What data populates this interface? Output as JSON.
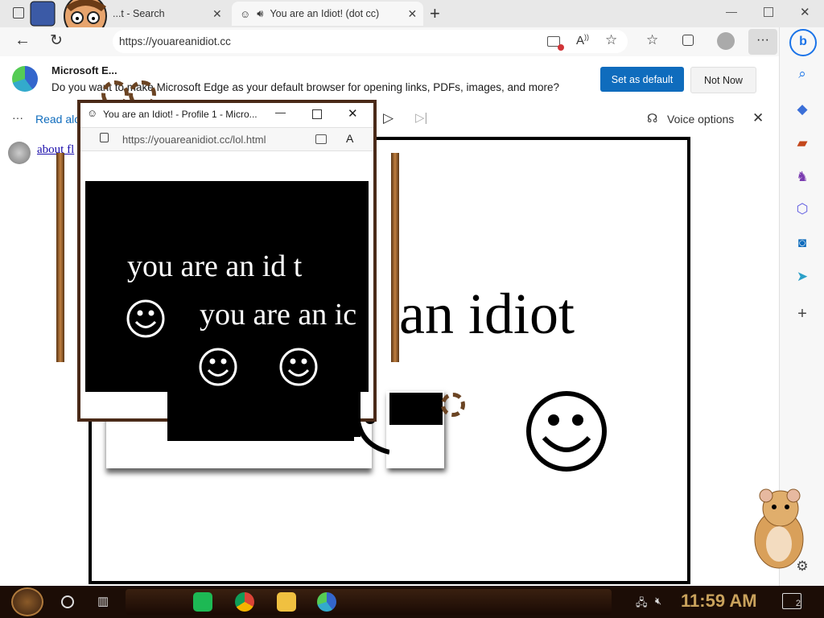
{
  "tabs": [
    {
      "title": "...t - Search"
    },
    {
      "title": "You are an Idiot! (dot cc)"
    }
  ],
  "toolbar": {
    "url": "https://youareanidiot.cc"
  },
  "infobar": {
    "title": "Microsoft E...",
    "message": "Do you want to make Microsoft Edge as your default browser for opening links, PDFs, images, and more?",
    "set_default": "Set as default",
    "not_now": "Not Now"
  },
  "readbar": {
    "label": "Read alo",
    "voice_options": "Voice options"
  },
  "page": {
    "link_text": "about fl",
    "main_text": "an idiot",
    "popup_text_a": "you are an id  t",
    "popup_text_b": "you are an ic"
  },
  "popup": {
    "title": "You are an Idiot! - Profile 1 - Micro...",
    "url": "https://youareanidiot.cc/lol.html"
  },
  "taskbar": {
    "time": "11:59 AM",
    "notifications": "2"
  },
  "colors": {
    "accent": "#0f6cbd",
    "taskbar": "#1c0d06",
    "frame": "#4a2a18"
  }
}
